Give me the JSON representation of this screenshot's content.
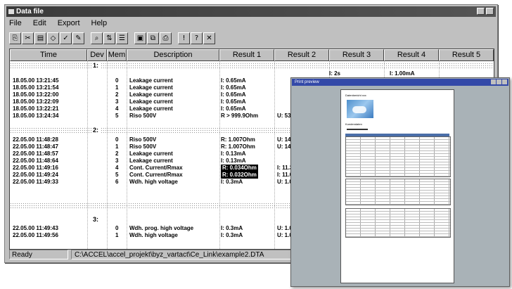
{
  "window": {
    "title": "Data file"
  },
  "menu": [
    "File",
    "Edit",
    "Export",
    "Help"
  ],
  "toolbar": [
    "copy-icon",
    "cut-icon",
    "paste-icon",
    "eraser-icon",
    "check-icon",
    "print-preview-icon",
    "search-icon",
    "filter-icon",
    "list-icon",
    "save-icon",
    "export-icon",
    "print-icon",
    "person-icon",
    "help-icon",
    "close-icon"
  ],
  "columns": [
    "Time",
    "Dev",
    "Mem",
    "Description",
    "Result 1",
    "Result 2",
    "Result 3",
    "Result 4",
    "Result 5"
  ],
  "groups": [
    {
      "label": "1:",
      "rows": [
        {
          "time": "18.05.00  13:21:45",
          "mem": "0",
          "desc": "Leakage current",
          "r1": "I: 0.65mA",
          "r2": ""
        },
        {
          "time": "18.05.00  13:21:54",
          "mem": "1",
          "desc": "Leakage current",
          "r1": "I: 0.65mA",
          "r2": ""
        },
        {
          "time": "18.05.00  13:22:00",
          "mem": "2",
          "desc": "Leakage current",
          "r1": "I: 0.65mA",
          "r2": ""
        },
        {
          "time": "18.05.00  13:22:09",
          "mem": "3",
          "desc": "Leakage current",
          "r1": "I: 0.65mA",
          "r2": ""
        },
        {
          "time": "18.05.00  13:22:21",
          "mem": "4",
          "desc": "Leakage current",
          "r1": "I: 0.65mA",
          "r2": ""
        },
        {
          "time": "18.05.00  13:24:34",
          "mem": "5",
          "desc": "Riso 500V",
          "r1": "R > 999.9Ohm",
          "r2": "U: 530"
        }
      ]
    },
    {
      "label": "2:",
      "rows": [
        {
          "time": "22.05.00  11:48:28",
          "mem": "0",
          "desc": "Riso 500V",
          "r1": "R: 1.007Ohm",
          "r2": "U: 144"
        },
        {
          "time": "22.05.00  11:48:47",
          "mem": "1",
          "desc": "Riso 500V",
          "r1": "R: 1.007Ohm",
          "r2": "U: 144"
        },
        {
          "time": "22.05.00  11:48:57",
          "mem": "2",
          "desc": "Leakage current",
          "r1": "I: 0.13mA",
          "r2": ""
        },
        {
          "time": "22.05.00  11:48:64",
          "mem": "3",
          "desc": "Leakage current",
          "r1": "I: 0.13mA",
          "r2": ""
        },
        {
          "time": "22.05.00  11:49:16",
          "mem": "4",
          "desc": "Cont. Current/Rmax",
          "r1": "R: 0.034Ohm",
          "r2": "I: 11.3",
          "hl": true
        },
        {
          "time": "22.05.00  11:49:24",
          "mem": "5",
          "desc": "Cont. Current/Rmax",
          "r1": "R: 0.032Ohm",
          "r2": "I: 11.0",
          "hl": true
        },
        {
          "time": "22.05.00  11:49:33",
          "mem": "6",
          "desc": "Wdh. high voltage",
          "r1": "I: 0.3mA",
          "r2": "U: 1.03"
        }
      ]
    },
    {
      "label": "3:",
      "rows": [
        {
          "time": "22.05.00  11:49:43",
          "mem": "0",
          "desc": "Wdh. prog. high voltage",
          "r1": "I: 0.3mA",
          "r2": "U: 1.03"
        },
        {
          "time": "22.05.00  11:49:56",
          "mem": "1",
          "desc": "Wdh. high voltage",
          "r1": "I: 0.3mA",
          "r2": "U: 1.03"
        }
      ]
    }
  ],
  "partial_row": {
    "r3": "I: 2s",
    "r4": "I: 1.00mA"
  },
  "status": {
    "state": "Ready",
    "path": "C:\\ACCEL\\accel_projekt\\byz_vartact\\Ce_Link\\example2.DTA"
  },
  "preview": {
    "title": "Print preview",
    "page_heading": "Datenbericht xxx",
    "page_subheading": "Kundendaten"
  }
}
